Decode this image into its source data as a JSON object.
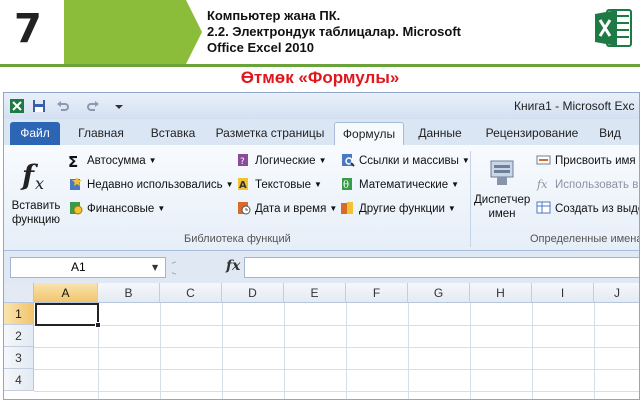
{
  "slide": {
    "number": "7",
    "title_line1": "Компьютер жана ПК.",
    "title_line2": "2.2. Электрондук таблицалар. Microsoft",
    "title_line3": "Office Excel 2010",
    "heading": "Өтмөк «Формулы»",
    "accent_color": "#8bbd3a",
    "heading_color": "#e0171d"
  },
  "excel": {
    "window_title": "Книга1 - Microsoft Exc",
    "tabs": [
      {
        "label": "Файл"
      },
      {
        "label": "Главная"
      },
      {
        "label": "Вставка"
      },
      {
        "label": "Разметка страницы"
      },
      {
        "label": "Формулы"
      },
      {
        "label": "Данные"
      },
      {
        "label": "Рецензирование"
      },
      {
        "label": "Вид"
      }
    ],
    "ribbon": {
      "insert_function_line1": "Вставить",
      "insert_function_line2": "функцию",
      "autosum": "Автосумма",
      "recent": "Недавно использовались",
      "financial": "Финансовые",
      "logical": "Логические",
      "text": "Текстовые",
      "datetime": "Дата и время",
      "lookup": "Ссылки и массивы",
      "math": "Математические",
      "other": "Другие функции",
      "library_label": "Библиотека функций",
      "name_manager_line1": "Диспетчер",
      "name_manager_line2": "имен",
      "define_name": "Присвоить имя",
      "use_in_formula": "Использовать в ф",
      "create_from_selection": "Создать из выде",
      "defined_names_label": "Определенные имена"
    },
    "name_box": "A1",
    "fx_symbol": "fx",
    "columns": [
      "A",
      "B",
      "C",
      "D",
      "E",
      "F",
      "G",
      "H",
      "I",
      "J"
    ],
    "rows": [
      "1",
      "2",
      "3",
      "4"
    ],
    "icons": {
      "fx_big": "function-icon",
      "sigma": "sigma-icon"
    }
  }
}
